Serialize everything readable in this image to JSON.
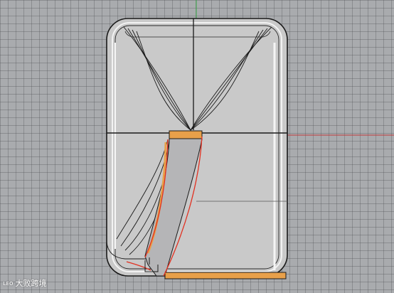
{
  "viewport": {
    "background": "#a9abae",
    "grid_color": "#7d7f83",
    "axis_x_color": "#c0393b",
    "axis_y_color": "#3aa84a"
  },
  "model": {
    "body_fill": "#c8c8c8",
    "edge_color": "#1a1a1a",
    "highlight_color": "#f2f2f2",
    "selected_face_color": "#e8a04a",
    "selected_curve_color": "#e23020"
  },
  "watermark": {
    "logo_text": "ʟᴇᴏ",
    "text": "大败跨境",
    "icon": "brand-logo-icon"
  }
}
